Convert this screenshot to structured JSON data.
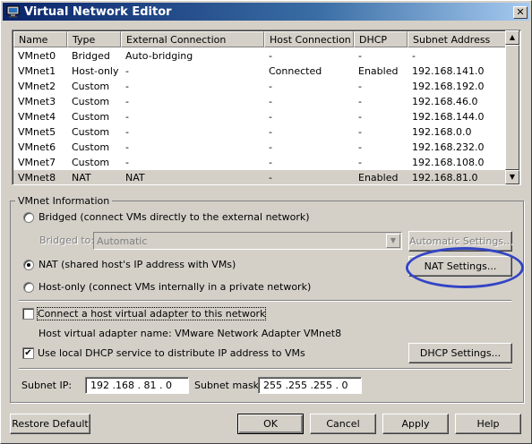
{
  "window": {
    "title": "Virtual Network Editor",
    "close_glyph": "✕",
    "app_icon": "network-app-icon"
  },
  "network_list": {
    "columns": [
      "Name",
      "Type",
      "External Connection",
      "Host Connection",
      "DHCP",
      "Subnet Address"
    ],
    "rows": [
      [
        "VMnet0",
        "Bridged",
        "Auto-bridging",
        "-",
        "-",
        "-"
      ],
      [
        "VMnet1",
        "Host-only",
        "-",
        "Connected",
        "Enabled",
        "192.168.141.0"
      ],
      [
        "VMnet2",
        "Custom",
        "-",
        "-",
        "-",
        "192.168.192.0"
      ],
      [
        "VMnet3",
        "Custom",
        "-",
        "-",
        "-",
        "192.168.46.0"
      ],
      [
        "VMnet4",
        "Custom",
        "-",
        "-",
        "-",
        "192.168.144.0"
      ],
      [
        "VMnet5",
        "Custom",
        "-",
        "-",
        "-",
        "192.168.0.0"
      ],
      [
        "VMnet6",
        "Custom",
        "-",
        "-",
        "-",
        "192.168.232.0"
      ],
      [
        "VMnet7",
        "Custom",
        "-",
        "-",
        "-",
        "192.168.108.0"
      ],
      [
        "VMnet8",
        "NAT",
        "NAT",
        "-",
        "Enabled",
        "192.168.81.0"
      ]
    ],
    "selected_row": 8,
    "scroll_up_glyph": "▲",
    "scroll_down_glyph": "▼"
  },
  "vmnet_info": {
    "group_label": "VMnet Information",
    "bridged_label": "Bridged (connect VMs directly to the external network)",
    "bridged_to_label": "Bridged to:",
    "bridged_to_value": "Automatic",
    "combo_arrow_glyph": "▼",
    "automatic_settings_label": "Automatic Settings...",
    "nat_label": "NAT (shared host's IP address with VMs)",
    "nat_settings_label": "NAT Settings...",
    "hostonly_label": "Host-only (connect VMs internally in a private network)",
    "selected_mode": "nat",
    "connect_adapter_label": "Connect a host virtual adapter to this network",
    "connect_adapter_checked": false,
    "adapter_name_label": "Host virtual adapter name: VMware Network Adapter VMnet8",
    "dhcp_label": "Use local DHCP service to distribute IP address to VMs",
    "dhcp_checked": true,
    "check_glyph": "✔",
    "dhcp_settings_label": "DHCP Settings...",
    "subnet_ip_label": "Subnet IP:",
    "subnet_ip_value": "192 .168 . 81  .  0",
    "subnet_mask_label": "Subnet mask:",
    "subnet_mask_value": "255 .255 .255 .  0"
  },
  "footer": {
    "restore_default_label": "Restore Default",
    "ok_label": "OK",
    "cancel_label": "Cancel",
    "apply_label": "Apply",
    "help_label": "Help"
  },
  "annotation": {
    "circle_color": "#3344c4"
  }
}
